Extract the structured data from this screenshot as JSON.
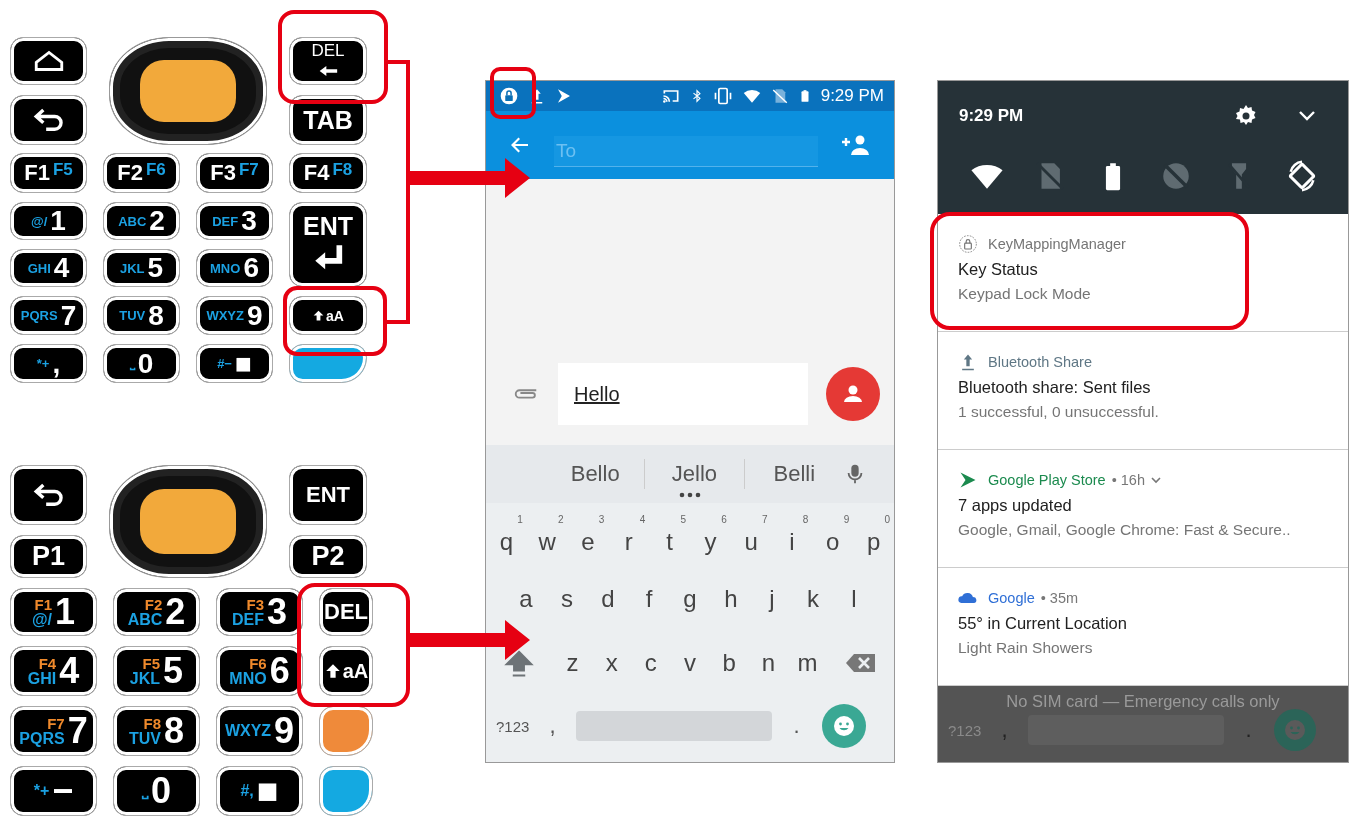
{
  "keypads": [
    {
      "top_keys": [
        {
          "kind": "home"
        },
        {
          "kind": "nav"
        },
        {
          "kind": "del",
          "label": "DEL"
        },
        {
          "kind": "back"
        },
        {
          "kind": "text",
          "label": "TAB"
        }
      ],
      "main_keys": [
        {
          "kind": "fkey",
          "label": "F1",
          "sub": "F5"
        },
        {
          "kind": "fkey",
          "label": "F2",
          "sub": "F6"
        },
        {
          "kind": "fkey",
          "label": "F3",
          "sub": "F7"
        },
        {
          "kind": "fkey",
          "label": "F4",
          "sub": "F8"
        },
        {
          "kind": "num",
          "sub": "@/",
          "label": "1"
        },
        {
          "kind": "num",
          "sub": "ABC",
          "label": "2"
        },
        {
          "kind": "num",
          "sub": "DEF",
          "label": "3"
        },
        {
          "kind": "enter",
          "label": "ENT"
        },
        {
          "kind": "num",
          "sub": "GHI",
          "label": "4"
        },
        {
          "kind": "num",
          "sub": "JKL",
          "label": "5"
        },
        {
          "kind": "num",
          "sub": "MNO",
          "label": "6"
        },
        {
          "kind": "num",
          "sub": "PQRS",
          "label": "7"
        },
        {
          "kind": "num",
          "sub": "TUV",
          "label": "8"
        },
        {
          "kind": "num",
          "sub": "WXYZ",
          "label": "9"
        },
        {
          "kind": "shift",
          "label": "aA"
        },
        {
          "kind": "num",
          "sub": "*+",
          "label": ","
        },
        {
          "kind": "num",
          "sub": "⎵",
          "label": "0"
        },
        {
          "kind": "num",
          "sub": "#−",
          "label": "■"
        },
        {
          "kind": "blank",
          "color": "#14a9e1"
        }
      ]
    },
    {
      "top_keys": [
        {
          "kind": "back"
        },
        {
          "kind": "nav"
        },
        {
          "kind": "text",
          "label": "ENT"
        },
        {
          "kind": "text",
          "label": "P1"
        },
        {
          "kind": "text",
          "label": "P2"
        }
      ],
      "main_keys": [
        {
          "kind": "num",
          "fn": "F1",
          "sub": "@/",
          "label": "1"
        },
        {
          "kind": "num",
          "fn": "F2",
          "sub": "ABC",
          "label": "2"
        },
        {
          "kind": "num",
          "fn": "F3",
          "sub": "DEF",
          "label": "3"
        },
        {
          "kind": "text",
          "label": "DEL"
        },
        {
          "kind": "num",
          "fn": "F4",
          "sub": "GHI",
          "label": "4"
        },
        {
          "kind": "num",
          "fn": "F5",
          "sub": "JKL",
          "label": "5"
        },
        {
          "kind": "num",
          "fn": "F6",
          "sub": "MNO",
          "label": "6"
        },
        {
          "kind": "shift",
          "label": "aA"
        },
        {
          "kind": "num",
          "fn": "F7",
          "sub": "PQRS",
          "label": "7"
        },
        {
          "kind": "num",
          "fn": "F8",
          "sub": "TUV",
          "label": "8"
        },
        {
          "kind": "num",
          "sub": "WXYZ",
          "label": "9"
        },
        {
          "kind": "blank",
          "color": "#ef8a3a"
        },
        {
          "kind": "num",
          "sub": "*+",
          "label": "−"
        },
        {
          "kind": "num",
          "sub": "⎵",
          "label": "0"
        },
        {
          "kind": "num",
          "sub": "#,",
          "label": "■"
        },
        {
          "kind": "blank",
          "color": "#14a9e1"
        }
      ]
    }
  ],
  "compose_screen": {
    "status_time": "9:29 PM",
    "to_placeholder": "To",
    "message": "Hello",
    "suggestions": [
      "Bello",
      "Jello",
      "Belli"
    ],
    "key_rows": [
      [
        {
          "label": "q",
          "hint": "1"
        },
        {
          "label": "w",
          "hint": "2"
        },
        {
          "label": "e",
          "hint": "3"
        },
        {
          "label": "r",
          "hint": "4"
        },
        {
          "label": "t",
          "hint": "5"
        },
        {
          "label": "y",
          "hint": "6"
        },
        {
          "label": "u",
          "hint": "7"
        },
        {
          "label": "i",
          "hint": "8"
        },
        {
          "label": "o",
          "hint": "9"
        },
        {
          "label": "p",
          "hint": "0"
        }
      ],
      [
        {
          "label": "a"
        },
        {
          "label": "s"
        },
        {
          "label": "d"
        },
        {
          "label": "f"
        },
        {
          "label": "g"
        },
        {
          "label": "h"
        },
        {
          "label": "j"
        },
        {
          "label": "k"
        },
        {
          "label": "l"
        }
      ],
      [
        {
          "label": "z"
        },
        {
          "label": "x"
        },
        {
          "label": "c"
        },
        {
          "label": "v"
        },
        {
          "label": "b"
        },
        {
          "label": "n"
        },
        {
          "label": "m"
        }
      ]
    ],
    "symbols_key": "?123",
    "comma_key": ",",
    "period_key": "."
  },
  "notification_screen": {
    "time": "9:29 PM",
    "quick_tiles": [
      {
        "kind": "wifi",
        "on": true
      },
      {
        "kind": "sim",
        "on": false
      },
      {
        "kind": "battery",
        "on": true
      },
      {
        "kind": "dnd",
        "on": false
      },
      {
        "kind": "flashlight",
        "on": false
      },
      {
        "kind": "rotate",
        "on": true
      }
    ],
    "notifications": [
      {
        "kind": "lock",
        "app": "KeyMappingManager",
        "color": "#757575",
        "expandable": false,
        "title": "Key Status",
        "text": "Keypad Lock Mode"
      },
      {
        "kind": "upload",
        "app": "Bluetooth Share",
        "color": "#5f7785",
        "expandable": false,
        "title": "Bluetooth share: Sent files",
        "text": "1 successful, 0 unsuccessful."
      },
      {
        "kind": "play",
        "app": "Google Play Store",
        "color": "#1b8a4e",
        "meta": "• 16h",
        "expandable": true,
        "title": "7 apps updated",
        "text": "Google, Gmail, Google Chrome: Fast & Secure.."
      },
      {
        "kind": "cloud",
        "app": "Google",
        "color": "#2f6fd6",
        "meta": "• 35m",
        "expandable": false,
        "title": "55° in Current Location",
        "text": "Light Rain Showers"
      }
    ],
    "carrier_text": "No SIM card — Emergency calls only",
    "background_keys": {
      "symbols_key": "?123",
      "comma_key": ",",
      "period_key": "."
    }
  }
}
